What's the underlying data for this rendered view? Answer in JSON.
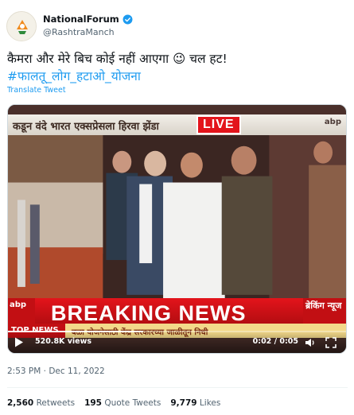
{
  "account": {
    "display_name": "NationalForum",
    "handle": "@RashtraManch"
  },
  "tweet": {
    "text": "कैमरा और मेरे बिच कोई नहीं आएगा 😉 चल हट!",
    "hashtag": "#फालतू_लोग_हटाओ_योजना",
    "translate_label": "Translate Tweet"
  },
  "video": {
    "live_label": "LIVE",
    "top_ticker": "कडून वंदे भारत एक्सप्रेसला हिरवा झेंडा",
    "top_channel": "abp",
    "left_channel": "abp",
    "breaking_label": "BREAKING NEWS",
    "right_tag": "ब्रेकिंग न्यूज",
    "top_news_label": "TOP NEWS",
    "bottom_ticker": "बळा योजनेसाठी केंद्र सरकारच्या जाळीतून निधी",
    "views": "520.8K views",
    "time_display": "0:02 / 0:05",
    "progress": 0.4
  },
  "meta": {
    "timestamp": "2:53 PM · Dec 11, 2022"
  },
  "stats": {
    "retweets_count": "2,560",
    "retweets_label": "Retweets",
    "quote_count": "195",
    "quote_label": "Quote Tweets",
    "likes_count": "9,779",
    "likes_label": "Likes"
  },
  "colors": {
    "accent": "#1d9bf0",
    "breaking_red": "#e3141b",
    "text_secondary": "#536471"
  }
}
